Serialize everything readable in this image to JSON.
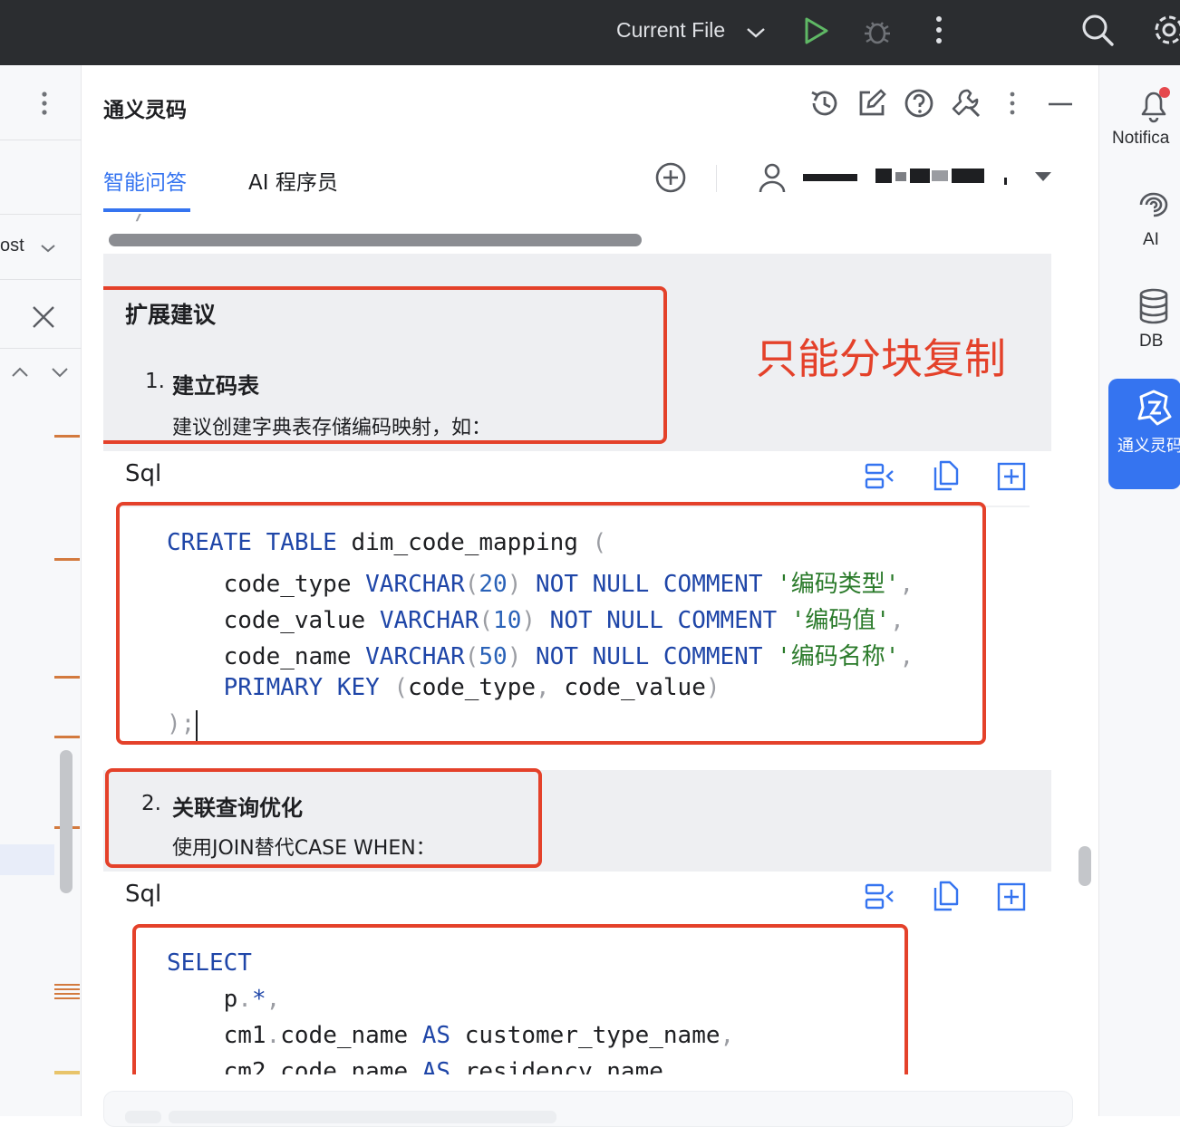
{
  "topbar": {
    "run_config_label": "Current File"
  },
  "left_panel": {
    "dropdown_label": "ost"
  },
  "panel": {
    "title": "通义灵码",
    "tabs": [
      {
        "label": "智能问答",
        "active": true
      },
      {
        "label": "AI 程序员",
        "active": false
      }
    ]
  },
  "right_toolbar": {
    "items": [
      {
        "label": "Notifica",
        "icon": "bell-icon"
      },
      {
        "label": "AI",
        "icon": "ai-swirl-icon"
      },
      {
        "label": "DB",
        "icon": "database-icon"
      },
      {
        "label": "通义灵码",
        "icon": "lingma-logo-icon",
        "active": true
      }
    ]
  },
  "conversation": {
    "section_heading": "扩展建议",
    "annotation": "只能分块复制",
    "item1": {
      "number": "1.",
      "title": "建立码表",
      "description": "建议创建字典表存储编码映射，如："
    },
    "item2": {
      "number": "2.",
      "title": "关联查询优化",
      "description": "使用JOIN替代CASE WHEN："
    },
    "code_block_1": {
      "language": "Sql"
    },
    "code_block_2": {
      "language": "Sql"
    }
  },
  "colors": {
    "accent": "#3574f0",
    "annotation_red": "#e4412a",
    "topbar_bg": "#2b2d30",
    "keyword_blue": "#1f46a8",
    "string_green": "#2a7a2a"
  }
}
